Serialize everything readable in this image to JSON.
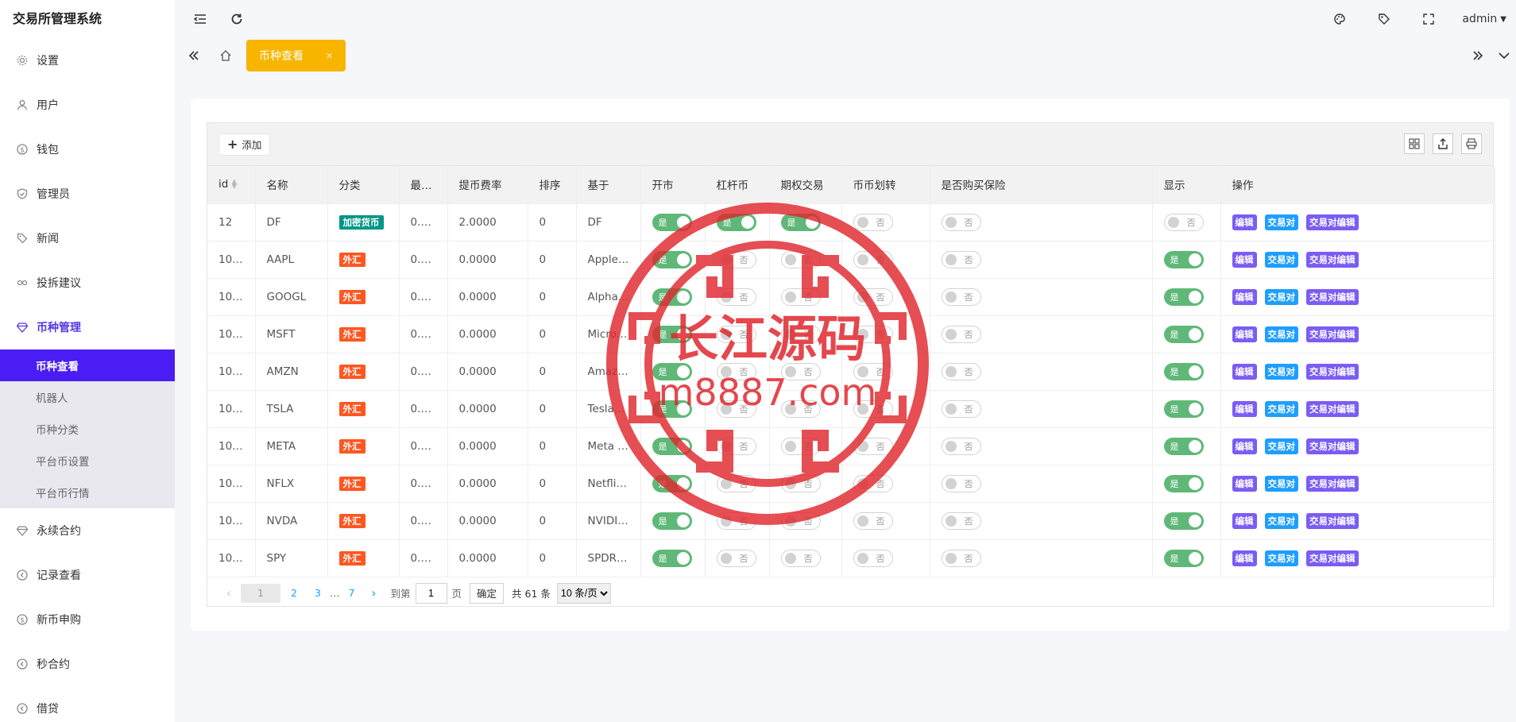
{
  "app": {
    "title": "交易所管理系统",
    "user": "admin"
  },
  "sidebar": {
    "items": [
      {
        "label": "设置",
        "icon": "gear-icon"
      },
      {
        "label": "用户",
        "icon": "user-icon"
      },
      {
        "label": "钱包",
        "icon": "dollar-icon"
      },
      {
        "label": "管理员",
        "icon": "shield-icon"
      },
      {
        "label": "新闻",
        "icon": "tag-icon"
      },
      {
        "label": "投拆建议",
        "icon": "link-icon"
      },
      {
        "label": "币种管理",
        "icon": "diamond-icon"
      }
    ],
    "sub_items": [
      "币种查看",
      "机器人",
      "币种分类",
      "平台币设置",
      "平台币行情"
    ],
    "items_after": [
      {
        "label": "永续合约",
        "icon": "diamond-icon"
      },
      {
        "label": "记录查看",
        "icon": "circle-arrow-icon"
      },
      {
        "label": "新币申购",
        "icon": "dollar-icon"
      },
      {
        "label": "秒合约",
        "icon": "circle-arrow-icon"
      },
      {
        "label": "借贷",
        "icon": "circle-arrow-icon"
      }
    ]
  },
  "tabs": {
    "active": "币种查看"
  },
  "toolbar": {
    "add_label": "添加"
  },
  "table": {
    "headers": [
      "id",
      "名称",
      "分类",
      "最…",
      "提币费率",
      "排序",
      "基于",
      "开市",
      "杠杆币",
      "期权交易",
      "币币划转",
      "是否购买保险",
      "显示",
      "操作"
    ],
    "switch_on": "是",
    "switch_off": "否",
    "op_labels": {
      "edit": "编辑",
      "pair": "交易对",
      "pair_edit": "交易对编辑"
    },
    "category_colors": {
      "加密货币": "#009688",
      "外汇": "#ff5722"
    },
    "rows": [
      {
        "id": "12",
        "name": "DF",
        "category": "加密货币",
        "min": "0.…",
        "fee": "2.0000",
        "sort": "0",
        "base": "DF",
        "open": true,
        "leverage": true,
        "options": true,
        "transfer": false,
        "insurance": false,
        "display": false
      },
      {
        "id": "10…",
        "name": "AAPL",
        "category": "外汇",
        "min": "0.…",
        "fee": "0.0000",
        "sort": "0",
        "base": "Apple …",
        "open": true,
        "leverage": false,
        "options": false,
        "transfer": false,
        "insurance": false,
        "display": true
      },
      {
        "id": "10…",
        "name": "GOOGL",
        "category": "外汇",
        "min": "0.…",
        "fee": "0.0000",
        "sort": "0",
        "base": "Alpha…",
        "open": true,
        "leverage": false,
        "options": false,
        "transfer": false,
        "insurance": false,
        "display": true
      },
      {
        "id": "10…",
        "name": "MSFT",
        "category": "外汇",
        "min": "0.…",
        "fee": "0.0000",
        "sort": "0",
        "base": "Micro…",
        "open": true,
        "leverage": false,
        "options": false,
        "transfer": false,
        "insurance": false,
        "display": true
      },
      {
        "id": "10…",
        "name": "AMZN",
        "category": "外汇",
        "min": "0.…",
        "fee": "0.0000",
        "sort": "0",
        "base": "Amaz…",
        "open": true,
        "leverage": false,
        "options": false,
        "transfer": false,
        "insurance": false,
        "display": true
      },
      {
        "id": "10…",
        "name": "TSLA",
        "category": "外汇",
        "min": "0.…",
        "fee": "0.0000",
        "sort": "0",
        "base": "Tesla…",
        "open": true,
        "leverage": false,
        "options": false,
        "transfer": false,
        "insurance": false,
        "display": true
      },
      {
        "id": "10…",
        "name": "META",
        "category": "外汇",
        "min": "0.…",
        "fee": "0.0000",
        "sort": "0",
        "base": "Meta …",
        "open": true,
        "leverage": false,
        "options": false,
        "transfer": false,
        "insurance": false,
        "display": true
      },
      {
        "id": "10…",
        "name": "NFLX",
        "category": "外汇",
        "min": "0.…",
        "fee": "0.0000",
        "sort": "0",
        "base": "Netflix…",
        "open": true,
        "leverage": false,
        "options": false,
        "transfer": false,
        "insurance": false,
        "display": true
      },
      {
        "id": "10…",
        "name": "NVDA",
        "category": "外汇",
        "min": "0.…",
        "fee": "0.0000",
        "sort": "0",
        "base": "NVIDI…",
        "open": true,
        "leverage": false,
        "options": false,
        "transfer": false,
        "insurance": false,
        "display": true
      },
      {
        "id": "10…",
        "name": "SPY",
        "category": "外汇",
        "min": "0.…",
        "fee": "0.0000",
        "sort": "0",
        "base": "SPDR…",
        "open": true,
        "leverage": false,
        "options": false,
        "transfer": false,
        "insurance": false,
        "display": true
      }
    ]
  },
  "pagination": {
    "current": "1",
    "pages": [
      "2",
      "3"
    ],
    "ellipsis": "…",
    "last": "7",
    "goto_label": "到第",
    "goto_value": "1",
    "page_unit": "页",
    "confirm": "确定",
    "total": "共 61 条",
    "page_size": "10 条/页"
  },
  "watermark": {
    "text": "长江源码",
    "url": "m8887.com",
    "color": "#e0282e"
  }
}
